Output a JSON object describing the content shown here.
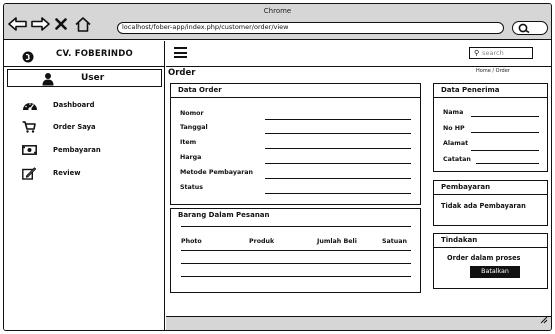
{
  "browser": {
    "window_title": "Chrome",
    "url": "localhost/fober-app/index.php/customer/order/view"
  },
  "sidebar": {
    "brand": "CV. FOBERINDO",
    "user_label": "User",
    "items": [
      {
        "label": "Dashboard",
        "icon": "dashboard-icon"
      },
      {
        "label": "Order Saya",
        "icon": "cart-icon"
      },
      {
        "label": "Pembayaran",
        "icon": "money-icon"
      },
      {
        "label": "Review",
        "icon": "edit-icon"
      }
    ]
  },
  "header": {
    "search_placeholder": "search"
  },
  "page": {
    "title": "Order",
    "breadcrumb": "Home / Order"
  },
  "data_order": {
    "title": "Data Order",
    "fields": [
      "Nomor",
      "Tanggal",
      "Item",
      "Harga",
      "Metode Pembayaran",
      "Status"
    ]
  },
  "barang": {
    "title": "Barang Dalam Pesanan",
    "columns": [
      "Photo",
      "Produk",
      "Jumlah Beli",
      "Satuan"
    ]
  },
  "penerima": {
    "title": "Data Penerima",
    "fields": [
      "Nama",
      "No HP",
      "Alamat",
      "Catatan"
    ]
  },
  "pembayaran": {
    "title": "Pembayaran",
    "message": "Tidak ada Pembayaran"
  },
  "tindakan": {
    "title": "Tindakan",
    "status_text": "Order dalam proses",
    "button_label": "Batalkan"
  }
}
